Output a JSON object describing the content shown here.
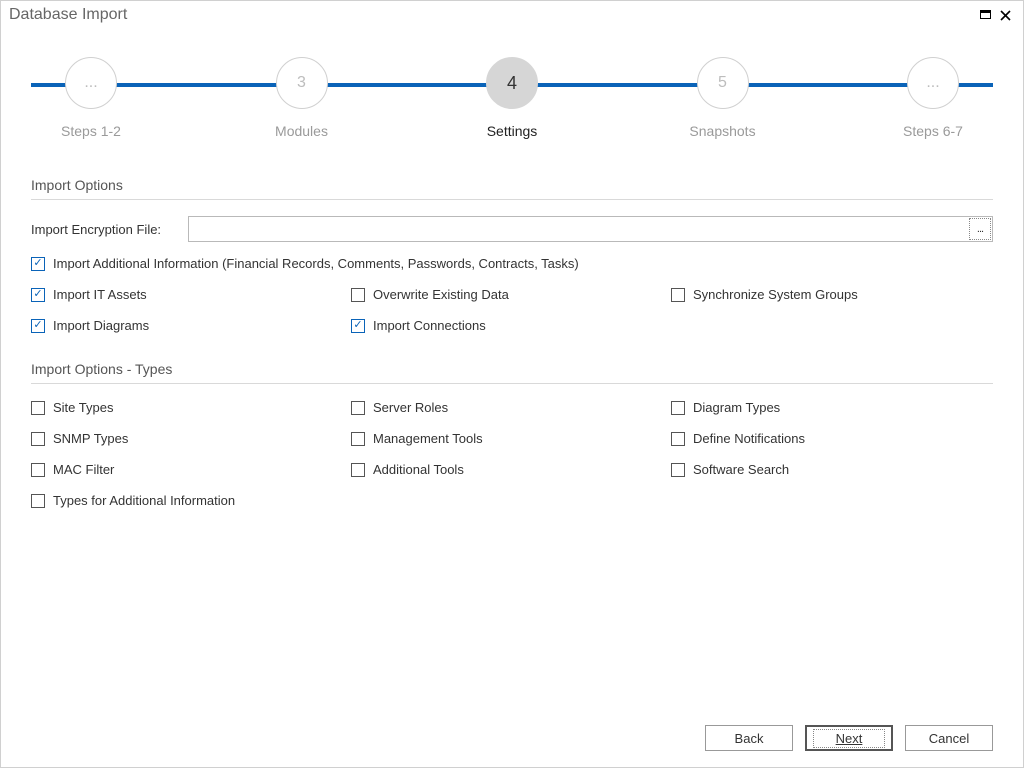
{
  "window": {
    "title": "Database Import"
  },
  "stepper": {
    "steps": [
      {
        "circle": "...",
        "label": "Steps 1-2",
        "active": false
      },
      {
        "circle": "3",
        "label": "Modules",
        "active": false
      },
      {
        "circle": "4",
        "label": "Settings",
        "active": true
      },
      {
        "circle": "5",
        "label": "Snapshots",
        "active": false
      },
      {
        "circle": "...",
        "label": "Steps 6-7",
        "active": false
      }
    ]
  },
  "section1": {
    "title": "Import Options",
    "encryption_label": "Import Encryption File:",
    "encryption_value": "",
    "browse_glyph": "...",
    "checks": {
      "addinfo": {
        "label": "Import Additional Information (Financial Records, Comments, Passwords, Contracts, Tasks)",
        "checked": true
      },
      "itassets": {
        "label": "Import IT Assets",
        "checked": true
      },
      "overwrite": {
        "label": "Overwrite Existing Data",
        "checked": false
      },
      "syncgrp": {
        "label": "Synchronize System Groups",
        "checked": false
      },
      "diagrams": {
        "label": "Import Diagrams",
        "checked": true
      },
      "conns": {
        "label": "Import Connections",
        "checked": true
      }
    }
  },
  "section2": {
    "title": "Import Options - Types",
    "checks": {
      "site": {
        "label": "Site Types",
        "checked": false
      },
      "roles": {
        "label": "Server Roles",
        "checked": false
      },
      "diagt": {
        "label": "Diagram Types",
        "checked": false
      },
      "snmp": {
        "label": "SNMP Types",
        "checked": false
      },
      "mgmt": {
        "label": "Management Tools",
        "checked": false
      },
      "notif": {
        "label": "Define Notifications",
        "checked": false
      },
      "mac": {
        "label": "MAC Filter",
        "checked": false
      },
      "addt": {
        "label": "Additional Tools",
        "checked": false
      },
      "softs": {
        "label": "Software Search",
        "checked": false
      },
      "typaddi": {
        "label": "Types for Additional Information",
        "checked": false
      }
    }
  },
  "footer": {
    "back": "Back",
    "next": "Next",
    "cancel": "Cancel"
  },
  "glyphs": {
    "check": "✓"
  }
}
